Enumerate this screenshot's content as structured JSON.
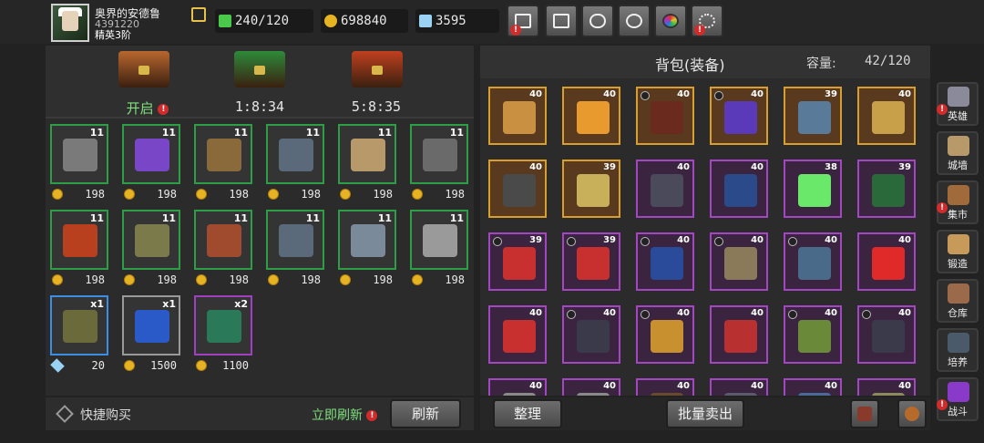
{
  "player": {
    "name": "奥界的安德鲁",
    "id": "4391220",
    "rank": "精英3阶"
  },
  "resources": {
    "stamina": "240/120",
    "gold": "698840",
    "diamond": "3595"
  },
  "top_buttons": [
    {
      "name": "shop",
      "icon": "cart-icon",
      "alert": true
    },
    {
      "name": "mail",
      "icon": "mail-icon",
      "alert": false
    },
    {
      "name": "gamepad",
      "icon": "gamepad-icon",
      "alert": false
    },
    {
      "name": "settings",
      "icon": "gear-icon",
      "alert": false
    },
    {
      "name": "color",
      "icon": "color-wheel-icon",
      "alert": false
    },
    {
      "name": "fireworks",
      "icon": "fireworks-icon",
      "alert": true
    }
  ],
  "chests": [
    {
      "label": "开启",
      "alert": true,
      "color": "#b8672e"
    },
    {
      "label": "1:8:34",
      "alert": false,
      "color": "#2e8a3a"
    },
    {
      "label": "5:8:35",
      "alert": false,
      "color": "#c0401e"
    }
  ],
  "shop_items": [
    {
      "qty": "11",
      "price": "198",
      "currency": "gold",
      "rarity": "green",
      "art": "#7a7a7a"
    },
    {
      "qty": "11",
      "price": "198",
      "currency": "gold",
      "rarity": "green",
      "art": "#7a46c8"
    },
    {
      "qty": "11",
      "price": "198",
      "currency": "gold",
      "rarity": "green",
      "art": "#8a6a3a"
    },
    {
      "qty": "11",
      "price": "198",
      "currency": "gold",
      "rarity": "green",
      "art": "#5a6a7a"
    },
    {
      "qty": "11",
      "price": "198",
      "currency": "gold",
      "rarity": "green",
      "art": "#b89a6a"
    },
    {
      "qty": "11",
      "price": "198",
      "currency": "gold",
      "rarity": "green",
      "art": "#6a6a6a"
    },
    {
      "qty": "11",
      "price": "198",
      "currency": "gold",
      "rarity": "green",
      "art": "#b8401e"
    },
    {
      "qty": "11",
      "price": "198",
      "currency": "gold",
      "rarity": "green",
      "art": "#7a7a4a"
    },
    {
      "qty": "11",
      "price": "198",
      "currency": "gold",
      "rarity": "green",
      "art": "#a04a2e"
    },
    {
      "qty": "11",
      "price": "198",
      "currency": "gold",
      "rarity": "green",
      "art": "#5a6a7a"
    },
    {
      "qty": "11",
      "price": "198",
      "currency": "gold",
      "rarity": "green",
      "art": "#7a8a9a"
    },
    {
      "qty": "11",
      "price": "198",
      "currency": "gold",
      "rarity": "green",
      "art": "#9a9a9a"
    },
    {
      "qty": "x1",
      "price": "20",
      "currency": "diamond",
      "rarity": "blue",
      "art": "#6a6a3a"
    },
    {
      "qty": "x1",
      "price": "1500",
      "currency": "gold",
      "rarity": "gray",
      "art": "#2a5ac8"
    },
    {
      "qty": "x2",
      "price": "1100",
      "currency": "gold",
      "rarity": "purple",
      "art": "#2a7a5a"
    }
  ],
  "left_footer": {
    "quick_buy": "快捷购买",
    "refresh_now": "立即刷新",
    "refresh": "刷新"
  },
  "bag": {
    "title": "背包(装备)",
    "capacity_label": "容量:",
    "capacity_value": "42/120",
    "slots": [
      {
        "level": "40",
        "rarity": "orange",
        "ring": false,
        "art": "#c89040"
      },
      {
        "level": "40",
        "rarity": "orange",
        "ring": false,
        "art": "#e89a2e"
      },
      {
        "level": "40",
        "rarity": "orange",
        "ring": true,
        "art": "#6a2a1e"
      },
      {
        "level": "40",
        "rarity": "orange",
        "ring": true,
        "art": "#5a3ab8"
      },
      {
        "level": "39",
        "rarity": "orange",
        "ring": false,
        "art": "#5a7a9a"
      },
      {
        "level": "40",
        "rarity": "orange",
        "ring": false,
        "art": "#c8a04a"
      },
      {
        "level": "40",
        "rarity": "orange",
        "ring": false,
        "art": "#4a4a4a"
      },
      {
        "level": "39",
        "rarity": "orange",
        "ring": false,
        "art": "#c8b05a"
      },
      {
        "level": "40",
        "rarity": "purple",
        "ring": false,
        "art": "#4a4a5a"
      },
      {
        "level": "40",
        "rarity": "purple",
        "ring": false,
        "art": "#2a4a8a"
      },
      {
        "level": "38",
        "rarity": "purple",
        "ring": false,
        "art": "#6ae86a"
      },
      {
        "level": "39",
        "rarity": "purple",
        "ring": false,
        "art": "#2a6a3a"
      },
      {
        "level": "39",
        "rarity": "purple",
        "ring": true,
        "art": "#c83030"
      },
      {
        "level": "39",
        "rarity": "purple",
        "ring": true,
        "art": "#c83030"
      },
      {
        "level": "40",
        "rarity": "purple",
        "ring": true,
        "art": "#2a4a9a"
      },
      {
        "level": "40",
        "rarity": "purple",
        "ring": true,
        "art": "#8a7a5a"
      },
      {
        "level": "40",
        "rarity": "purple",
        "ring": true,
        "art": "#4a6a8a"
      },
      {
        "level": "40",
        "rarity": "purple",
        "ring": false,
        "art": "#e02a2a"
      },
      {
        "level": "40",
        "rarity": "purple",
        "ring": false,
        "art": "#c83030"
      },
      {
        "level": "40",
        "rarity": "purple",
        "ring": true,
        "art": "#3a3a4a"
      },
      {
        "level": "40",
        "rarity": "purple",
        "ring": true,
        "art": "#c8902e"
      },
      {
        "level": "40",
        "rarity": "purple",
        "ring": false,
        "art": "#b83030"
      },
      {
        "level": "40",
        "rarity": "purple",
        "ring": true,
        "art": "#6a8a3a"
      },
      {
        "level": "40",
        "rarity": "purple",
        "ring": true,
        "art": "#3a3a4a"
      },
      {
        "level": "40",
        "rarity": "purple",
        "ring": false,
        "art": "#8a8a8a"
      },
      {
        "level": "40",
        "rarity": "purple",
        "ring": false,
        "art": "#8a8a8a"
      },
      {
        "level": "40",
        "rarity": "purple",
        "ring": false,
        "art": "#6a4a2e"
      },
      {
        "level": "40",
        "rarity": "purple",
        "ring": false,
        "art": "#5a5a6a"
      },
      {
        "level": "40",
        "rarity": "purple",
        "ring": false,
        "art": "#4a6a9a"
      },
      {
        "level": "40",
        "rarity": "purple",
        "ring": false,
        "art": "#8a8a5a"
      }
    ],
    "sort_label": "整理",
    "sell_label": "批量卖出"
  },
  "sidebar": [
    {
      "label": "英雄",
      "icon": "hero-helmet-icon",
      "alert": true,
      "color": "#8a8a9a"
    },
    {
      "label": "城墙",
      "icon": "wall-icon",
      "alert": false,
      "color": "#b89a6a"
    },
    {
      "label": "集市",
      "icon": "market-icon",
      "alert": true,
      "color": "#a06a3a"
    },
    {
      "label": "锻造",
      "icon": "anvil-icon",
      "alert": false,
      "color": "#c89a5a"
    },
    {
      "label": "仓库",
      "icon": "warehouse-icon",
      "alert": false,
      "color": "#9a6a4a"
    },
    {
      "label": "培养",
      "icon": "train-icon",
      "alert": false,
      "color": "#4a5a6a"
    },
    {
      "label": "战斗",
      "icon": "battle-portal-icon",
      "alert": true,
      "color": "#8a3ac8"
    }
  ]
}
